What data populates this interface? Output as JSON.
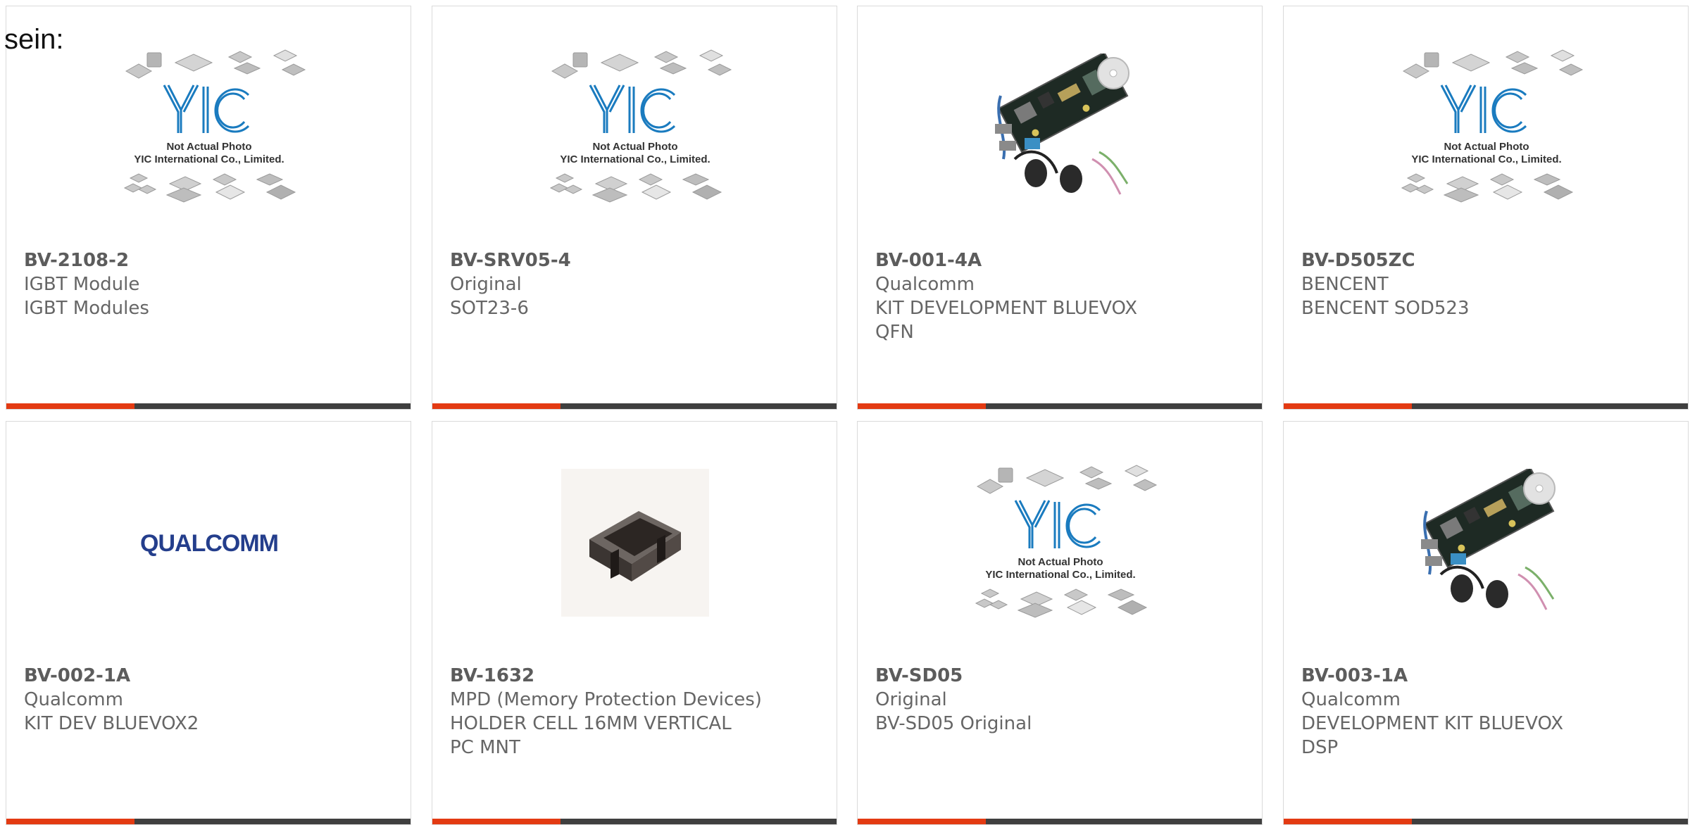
{
  "intro": "sein:",
  "colors": {
    "accent": "#e33a12",
    "bar": "#3f3f3f",
    "text": "#666666"
  },
  "placeholder": {
    "line1": "Not Actual Photo",
    "line2": "YIC International Co., Limited."
  },
  "products": [
    {
      "part": "BV-2108-2",
      "lines": [
        "IGBT Module",
        "IGBT Modules"
      ],
      "image": "yic-placeholder"
    },
    {
      "part": "BV-SRV05-4",
      "lines": [
        "Original",
        "SOT23-6"
      ],
      "image": "yic-placeholder"
    },
    {
      "part": "BV-001-4A",
      "lines": [
        "Qualcomm",
        "KIT DEVELOPMENT BLUEVOX",
        "QFN"
      ],
      "image": "dev-kit-photo"
    },
    {
      "part": "BV-D505ZC",
      "lines": [
        "BENCENT",
        "BENCENT SOD523"
      ],
      "image": "yic-placeholder"
    },
    {
      "part": "BV-002-1A",
      "lines": [
        "Qualcomm",
        "KIT DEV BLUEVOX2"
      ],
      "image": "qualcomm-logo",
      "logo_text": "QUALCOMM"
    },
    {
      "part": "BV-1632",
      "lines": [
        "MPD (Memory Protection Devices)",
        "HOLDER CELL 16MM VERTICAL",
        "PC MNT"
      ],
      "image": "battery-holder-photo"
    },
    {
      "part": "BV-SD05",
      "lines": [
        "Original",
        "BV-SD05 Original"
      ],
      "image": "yic-placeholder"
    },
    {
      "part": "BV-003-1A",
      "lines": [
        "Qualcomm",
        "DEVELOPMENT KIT BLUEVOX",
        "DSP"
      ],
      "image": "dev-kit-photo"
    }
  ]
}
